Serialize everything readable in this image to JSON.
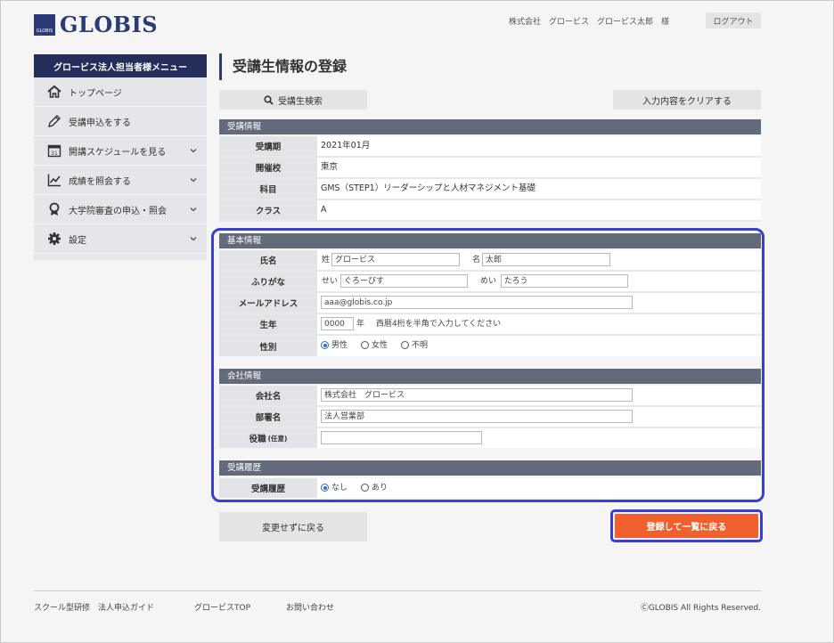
{
  "header": {
    "logo_box_text": "GLOBIS",
    "logo_text": "GLOBIS",
    "user_info": "株式会社　グロービス　グロービス太郎　様",
    "logout_label": "ログアウト"
  },
  "sidebar": {
    "title": "グロービス法人担当者様メニュー",
    "items": [
      {
        "label": "トップページ",
        "icon": "home-icon",
        "has_chevron": false
      },
      {
        "label": "受講申込をする",
        "icon": "pencil-icon",
        "has_chevron": false
      },
      {
        "label": "開講スケジュールを見る",
        "icon": "calendar-icon",
        "has_chevron": true
      },
      {
        "label": "成績を照会する",
        "icon": "chart-icon",
        "has_chevron": true
      },
      {
        "label": "大学院審査の申込・照会",
        "icon": "award-icon",
        "has_chevron": true
      },
      {
        "label": "設定",
        "icon": "gear-icon",
        "has_chevron": true
      }
    ]
  },
  "main": {
    "title": "受講生情報の登録",
    "search_button": "受講生検索",
    "clear_button": "入力内容をクリアする",
    "enrollment": {
      "heading": "受講情報",
      "rows": [
        {
          "label": "受講期",
          "value": "2021年01月"
        },
        {
          "label": "開催校",
          "value": "東京"
        },
        {
          "label": "科目",
          "value": "GMS（STEP1）リーダーシップと人材マネジメント基礎"
        },
        {
          "label": "クラス",
          "value": "A"
        }
      ]
    },
    "basic": {
      "heading": "基本情報",
      "name_label": "氏名",
      "last_name_prefix": "姓",
      "last_name_value": "グロービス",
      "first_name_prefix": "名",
      "first_name_value": "太郎",
      "kana_label": "ふりがな",
      "last_kana_prefix": "せい",
      "last_kana_value": "ぐろーびす",
      "first_kana_prefix": "めい",
      "first_kana_value": "たろう",
      "email_label": "メールアドレス",
      "email_value": "aaa@globis.co.jp",
      "birth_label": "生年",
      "birth_value": "0000",
      "birth_suffix": "年",
      "birth_hint": "西暦4桁を半角で入力してください",
      "gender_label": "性別",
      "gender_options": [
        "男性",
        "女性",
        "不明"
      ],
      "gender_selected": "男性"
    },
    "company": {
      "heading": "会社情報",
      "company_label": "会社名",
      "company_value": "株式会社　グロービス",
      "dept_label": "部署名",
      "dept_value": "法人営業部",
      "title_label": "役職",
      "title_optional": "(任意)",
      "title_value": ""
    },
    "history": {
      "heading": "受講履歴",
      "label": "受講履歴",
      "options": [
        "なし",
        "あり"
      ],
      "selected": "なし"
    },
    "back_button": "変更せずに戻る",
    "submit_button": "登録して一覧に戻る"
  },
  "footer": {
    "links": [
      "スクール型研修　法人申込ガイド",
      "グロービスTOP",
      "お問い合わせ"
    ],
    "copyright": "ⒸGLOBIS All Rights Reserved."
  },
  "colors": {
    "navy": "#252d5a",
    "section_header": "#636b7b",
    "submit": "#f0602e",
    "highlight": "#3b3fd1"
  }
}
